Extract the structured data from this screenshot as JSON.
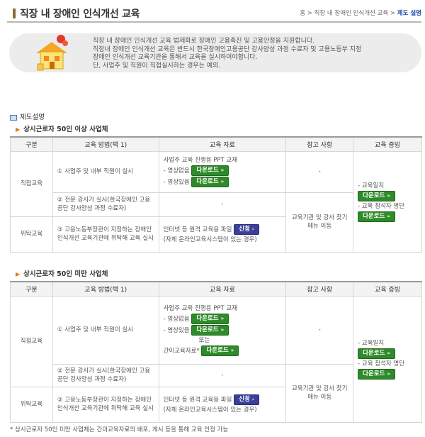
{
  "header": {
    "title": "직장 내 장애인 인식개선 교육",
    "breadcrumb": [
      "홈",
      "직장 내 장애인 인식개선 교육",
      "제도 설명"
    ]
  },
  "banner": {
    "lines": [
      "직장 내 장애인 인식개선 교육 법제화로 장애인 고용촉진 및 고용안정을 지원합니다.",
      "직장내 장애인 인식개선 교육은 반드시 한국장애인고용공단 강사양성 과정 수료자 및 고용노동부 지정",
      "장애인 인식개선 교육기관을 통해서 교육을 실시하여야합니다.",
      "단, 사업주 및 직원이 직접실시하는 경우는 예외."
    ]
  },
  "section_title": "제도설명",
  "headers": [
    "구분",
    "교육 방법(택 1)",
    "교육 자료",
    "참고 사항",
    "교육 증빙"
  ],
  "labels": {
    "direct": "직접교육",
    "consign": "위탁교육",
    "method1": "① 사업주 및 내부 직원이 실시",
    "method2": "② 전문 강사가 실시(한국장애인 고용공단 강사양성 과정 수료자)",
    "method3": "③ 고용노동부장관이 지정하는 장애인 인식개선 교육기관에 위탁해 교육 실시",
    "ppt": "사업주 교육 진행용 PPT 교재",
    "video_no": "- 영상없음",
    "video_yes": "- 영상있음",
    "or": "또는",
    "simple": "간이교육자료*",
    "dash": "-",
    "online": "인터넷 등 원격 교육용 파일",
    "online_note": "(자체 온라인교육시스템이 있는 경우)",
    "note": "교육기관 및 강사 찾기 메뉴 이동",
    "log": "- 교육일지",
    "roster": "- 교육 참석자 명단",
    "download": "다운로드",
    "apply": "신청"
  },
  "section1": {
    "title": "상시근로자 50인 이상 사업체"
  },
  "section2": {
    "title": "상시근로자 50인 미만 사업체"
  },
  "footnote": "* 상시근로자 50인 미만 사업체는 간이교육자료의 배포, 게시 등을 통해 교육 인정 가능",
  "colors": {
    "download_btn": "#2f8a2a",
    "apply_btn": "#3b3f9a",
    "accent": "#e07c00"
  }
}
